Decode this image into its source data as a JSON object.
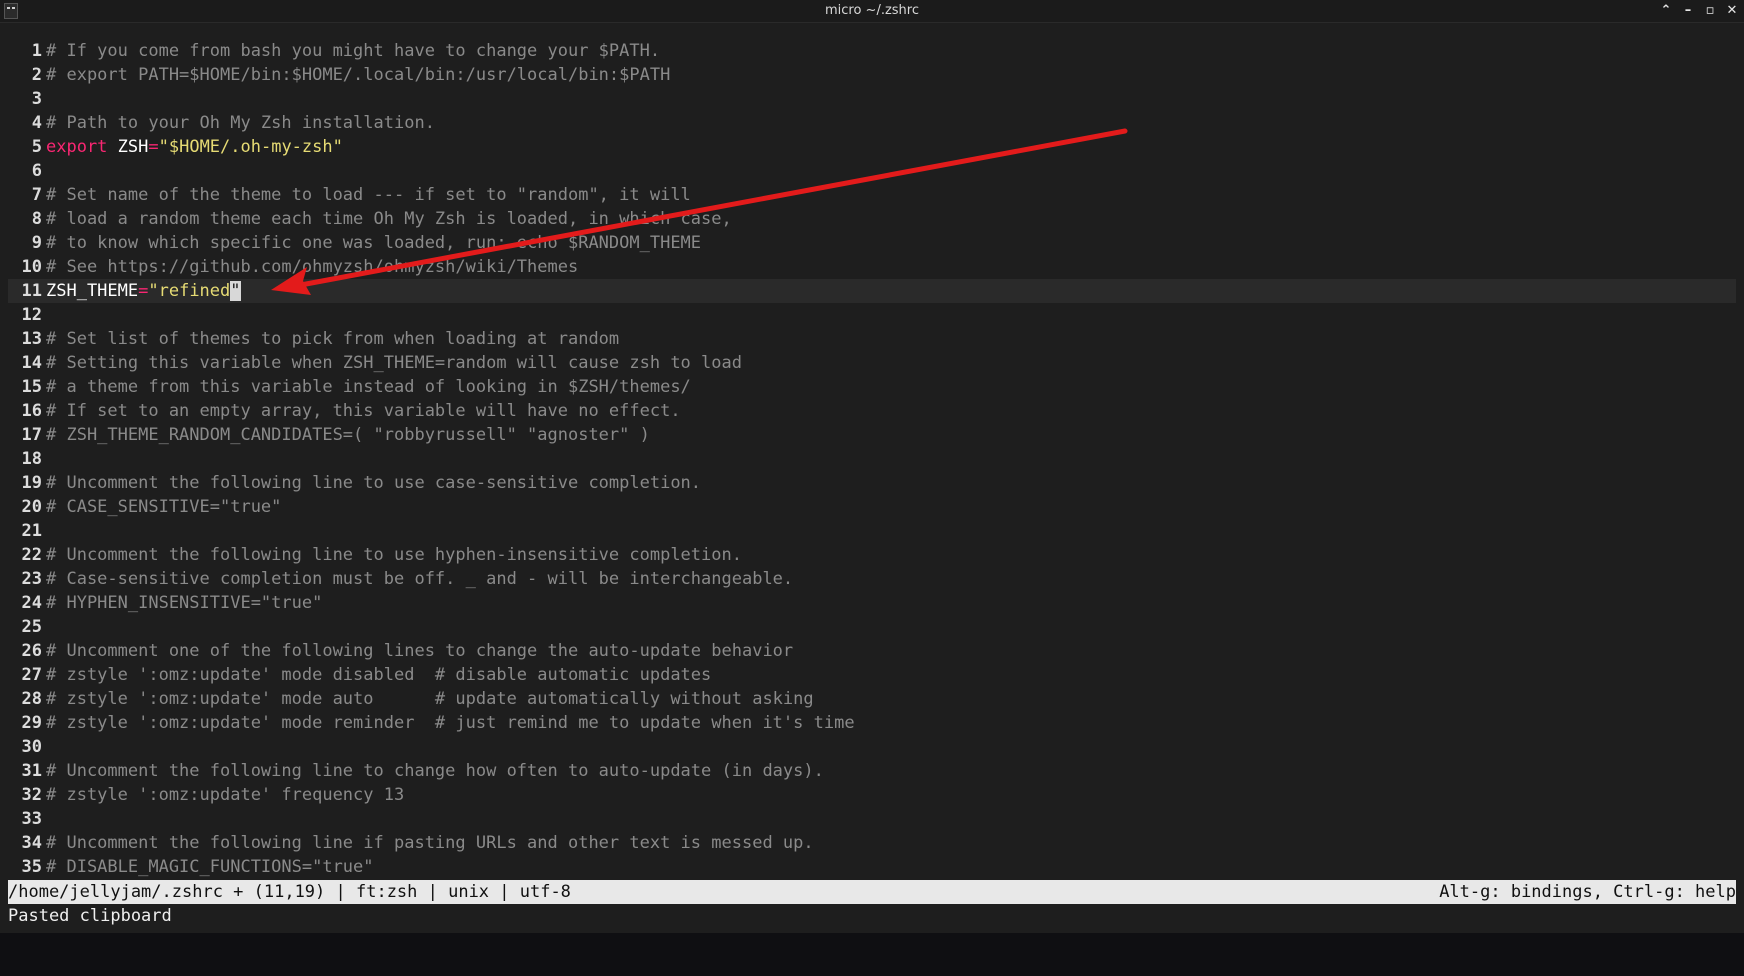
{
  "window": {
    "title": "micro ~/.zshrc",
    "controls": {
      "minimize_up": "⌃",
      "minimize": "–",
      "maximize": "▫",
      "close": "✕"
    }
  },
  "editor": {
    "lines": [
      {
        "n": "1",
        "tokens": [
          {
            "c": "cm",
            "t": "# If you come from bash you might have to change your $PATH."
          }
        ]
      },
      {
        "n": "2",
        "tokens": [
          {
            "c": "cm",
            "t": "# export PATH=$HOME/bin:$HOME/.local/bin:/usr/local/bin:$PATH"
          }
        ]
      },
      {
        "n": "3",
        "tokens": []
      },
      {
        "n": "4",
        "tokens": [
          {
            "c": "cm",
            "t": "# Path to your Oh My Zsh installation."
          }
        ]
      },
      {
        "n": "5",
        "tokens": [
          {
            "c": "kw",
            "t": "export"
          },
          {
            "c": "var",
            "t": " ZSH"
          },
          {
            "c": "op",
            "t": "="
          },
          {
            "c": "str",
            "t": "\"$HOME/.oh-my-zsh\""
          }
        ]
      },
      {
        "n": "6",
        "tokens": []
      },
      {
        "n": "7",
        "tokens": [
          {
            "c": "cm",
            "t": "# Set name of the theme to load --- if set to \"random\", it will"
          }
        ]
      },
      {
        "n": "8",
        "tokens": [
          {
            "c": "cm",
            "t": "# load a random theme each time Oh My Zsh is loaded, in which case,"
          }
        ]
      },
      {
        "n": "9",
        "tokens": [
          {
            "c": "cm",
            "t": "# to know which specific one was loaded, run: echo $RANDOM_THEME"
          }
        ]
      },
      {
        "n": "10",
        "tokens": [
          {
            "c": "cm",
            "t": "# See https://github.com/ohmyzsh/ohmyzsh/wiki/Themes"
          }
        ]
      },
      {
        "n": "11",
        "current": true,
        "tokens": [
          {
            "c": "var",
            "t": "ZSH_THEME"
          },
          {
            "c": "op",
            "t": "="
          },
          {
            "c": "str",
            "t": "\"refined"
          },
          {
            "c": "cursor",
            "t": "\""
          }
        ]
      },
      {
        "n": "12",
        "tokens": []
      },
      {
        "n": "13",
        "tokens": [
          {
            "c": "cm",
            "t": "# Set list of themes to pick from when loading at random"
          }
        ]
      },
      {
        "n": "14",
        "tokens": [
          {
            "c": "cm",
            "t": "# Setting this variable when ZSH_THEME=random will cause zsh to load"
          }
        ]
      },
      {
        "n": "15",
        "tokens": [
          {
            "c": "cm",
            "t": "# a theme from this variable instead of looking in $ZSH/themes/"
          }
        ]
      },
      {
        "n": "16",
        "tokens": [
          {
            "c": "cm",
            "t": "# If set to an empty array, this variable will have no effect."
          }
        ]
      },
      {
        "n": "17",
        "tokens": [
          {
            "c": "cm",
            "t": "# ZSH_THEME_RANDOM_CANDIDATES=( \"robbyrussell\" \"agnoster\" )"
          }
        ]
      },
      {
        "n": "18",
        "tokens": []
      },
      {
        "n": "19",
        "tokens": [
          {
            "c": "cm",
            "t": "# Uncomment the following line to use case-sensitive completion."
          }
        ]
      },
      {
        "n": "20",
        "tokens": [
          {
            "c": "cm",
            "t": "# CASE_SENSITIVE=\"true\""
          }
        ]
      },
      {
        "n": "21",
        "tokens": []
      },
      {
        "n": "22",
        "tokens": [
          {
            "c": "cm",
            "t": "# Uncomment the following line to use hyphen-insensitive completion."
          }
        ]
      },
      {
        "n": "23",
        "tokens": [
          {
            "c": "cm",
            "t": "# Case-sensitive completion must be off. _ and - will be interchangeable."
          }
        ]
      },
      {
        "n": "24",
        "tokens": [
          {
            "c": "cm",
            "t": "# HYPHEN_INSENSITIVE=\"true\""
          }
        ]
      },
      {
        "n": "25",
        "tokens": []
      },
      {
        "n": "26",
        "tokens": [
          {
            "c": "cm",
            "t": "# Uncomment one of the following lines to change the auto-update behavior"
          }
        ]
      },
      {
        "n": "27",
        "tokens": [
          {
            "c": "cm",
            "t": "# zstyle ':omz:update' mode disabled  # disable automatic updates"
          }
        ]
      },
      {
        "n": "28",
        "tokens": [
          {
            "c": "cm",
            "t": "# zstyle ':omz:update' mode auto      # update automatically without asking"
          }
        ]
      },
      {
        "n": "29",
        "tokens": [
          {
            "c": "cm",
            "t": "# zstyle ':omz:update' mode reminder  # just remind me to update when it's time"
          }
        ]
      },
      {
        "n": "30",
        "tokens": []
      },
      {
        "n": "31",
        "tokens": [
          {
            "c": "cm",
            "t": "# Uncomment the following line to change how often to auto-update (in days)."
          }
        ]
      },
      {
        "n": "32",
        "tokens": [
          {
            "c": "cm",
            "t": "# zstyle ':omz:update' frequency 13"
          }
        ]
      },
      {
        "n": "33",
        "tokens": []
      },
      {
        "n": "34",
        "tokens": [
          {
            "c": "cm",
            "t": "# Uncomment the following line if pasting URLs and other text is messed up."
          }
        ]
      },
      {
        "n": "35",
        "tokens": [
          {
            "c": "cm",
            "t": "# DISABLE_MAGIC_FUNCTIONS=\"true\""
          }
        ]
      }
    ]
  },
  "statusbar": {
    "left": "/home/jellyjam/.zshrc + (11,19) | ft:zsh | unix | utf-8",
    "right": "Alt-g: bindings, Ctrl-g: help"
  },
  "messagebar": {
    "text": "Pasted clipboard"
  },
  "annotation": {
    "color": "#e31b1b"
  }
}
